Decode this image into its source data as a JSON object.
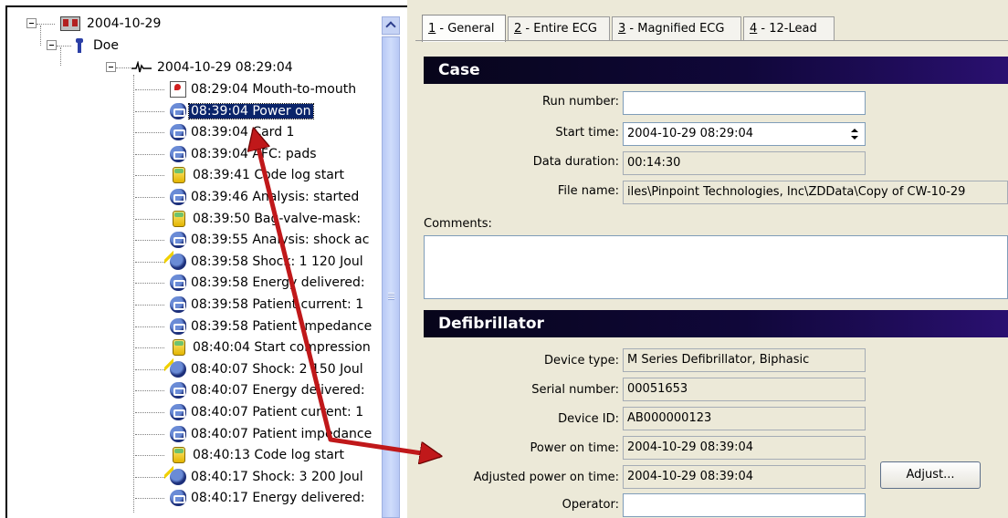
{
  "tree": {
    "root_date": "2004-10-29",
    "patient": "Doe",
    "case": "2004-10-29 08:29:04",
    "events": [
      {
        "icon": "mouth",
        "text": "08:29:04 Mouth-to-mouth",
        "selected": false
      },
      {
        "icon": "device",
        "text": "08:39:04 Power on",
        "selected": true
      },
      {
        "icon": "device",
        "text": "08:39:04 Card 1",
        "selected": false
      },
      {
        "icon": "device",
        "text": "08:39:04 AFC: pads",
        "selected": false
      },
      {
        "icon": "code",
        "text": "08:39:41 Code log start",
        "selected": false
      },
      {
        "icon": "device",
        "text": "08:39:46 Analysis: started",
        "selected": false
      },
      {
        "icon": "code",
        "text": "08:39:50 Bag-valve-mask:",
        "selected": false
      },
      {
        "icon": "device",
        "text": "08:39:55 Analysis: shock ac",
        "selected": false
      },
      {
        "icon": "shock",
        "text": "08:39:58 Shock: 1 120 Joul",
        "selected": false
      },
      {
        "icon": "device",
        "text": "08:39:58 Energy delivered:",
        "selected": false
      },
      {
        "icon": "device",
        "text": "08:39:58 Patient current: 1",
        "selected": false
      },
      {
        "icon": "device",
        "text": "08:39:58 Patient impedance",
        "selected": false
      },
      {
        "icon": "code",
        "text": "08:40:04 Start compression",
        "selected": false
      },
      {
        "icon": "shock",
        "text": "08:40:07 Shock: 2 150 Joul",
        "selected": false
      },
      {
        "icon": "device",
        "text": "08:40:07 Energy delivered:",
        "selected": false
      },
      {
        "icon": "device",
        "text": "08:40:07 Patient current: 1",
        "selected": false
      },
      {
        "icon": "device",
        "text": "08:40:07 Patient impedance",
        "selected": false
      },
      {
        "icon": "code",
        "text": "08:40:13 Code log start",
        "selected": false
      },
      {
        "icon": "shock",
        "text": "08:40:17 Shock: 3 200 Joul",
        "selected": false
      },
      {
        "icon": "device",
        "text": "08:40:17 Energy delivered:",
        "selected": false
      }
    ]
  },
  "tabs": [
    {
      "num": "1",
      "label": " - General",
      "active": true
    },
    {
      "num": "2",
      "label": " - Entire ECG",
      "active": false
    },
    {
      "num": "3",
      "label": " - Magnified ECG",
      "active": false
    },
    {
      "num": "4",
      "label": " - 12-Lead",
      "active": false
    }
  ],
  "case": {
    "header": "Case",
    "run_number_label": "Run number:",
    "run_number": "",
    "start_time_label": "Start time:",
    "start_time": "2004-10-29 08:29:04",
    "data_duration_label": "Data duration:",
    "data_duration": "00:14:30",
    "file_name_label": "File name:",
    "file_name": "iles\\Pinpoint Technologies, Inc\\ZDData\\Copy of CW-10-29",
    "comments_label": "Comments:"
  },
  "defib": {
    "header": "Defibrillator",
    "device_type_label": "Device type:",
    "device_type": "M Series Defibrillator, Biphasic",
    "serial_label": "Serial number:",
    "serial": "00051653",
    "device_id_label": "Device ID:",
    "device_id": "AB000000123",
    "power_on_label": "Power on time:",
    "power_on": "2004-10-29 08:39:04",
    "adjusted_label": "Adjusted power on time:",
    "adjusted": "2004-10-29 08:39:04",
    "adjust_button": "Adjust...",
    "operator_label": "Operator:",
    "operator": ""
  },
  "colors": {
    "arrow": "#c0181a",
    "selection": "#0a246a",
    "section_header": "#10073a"
  }
}
